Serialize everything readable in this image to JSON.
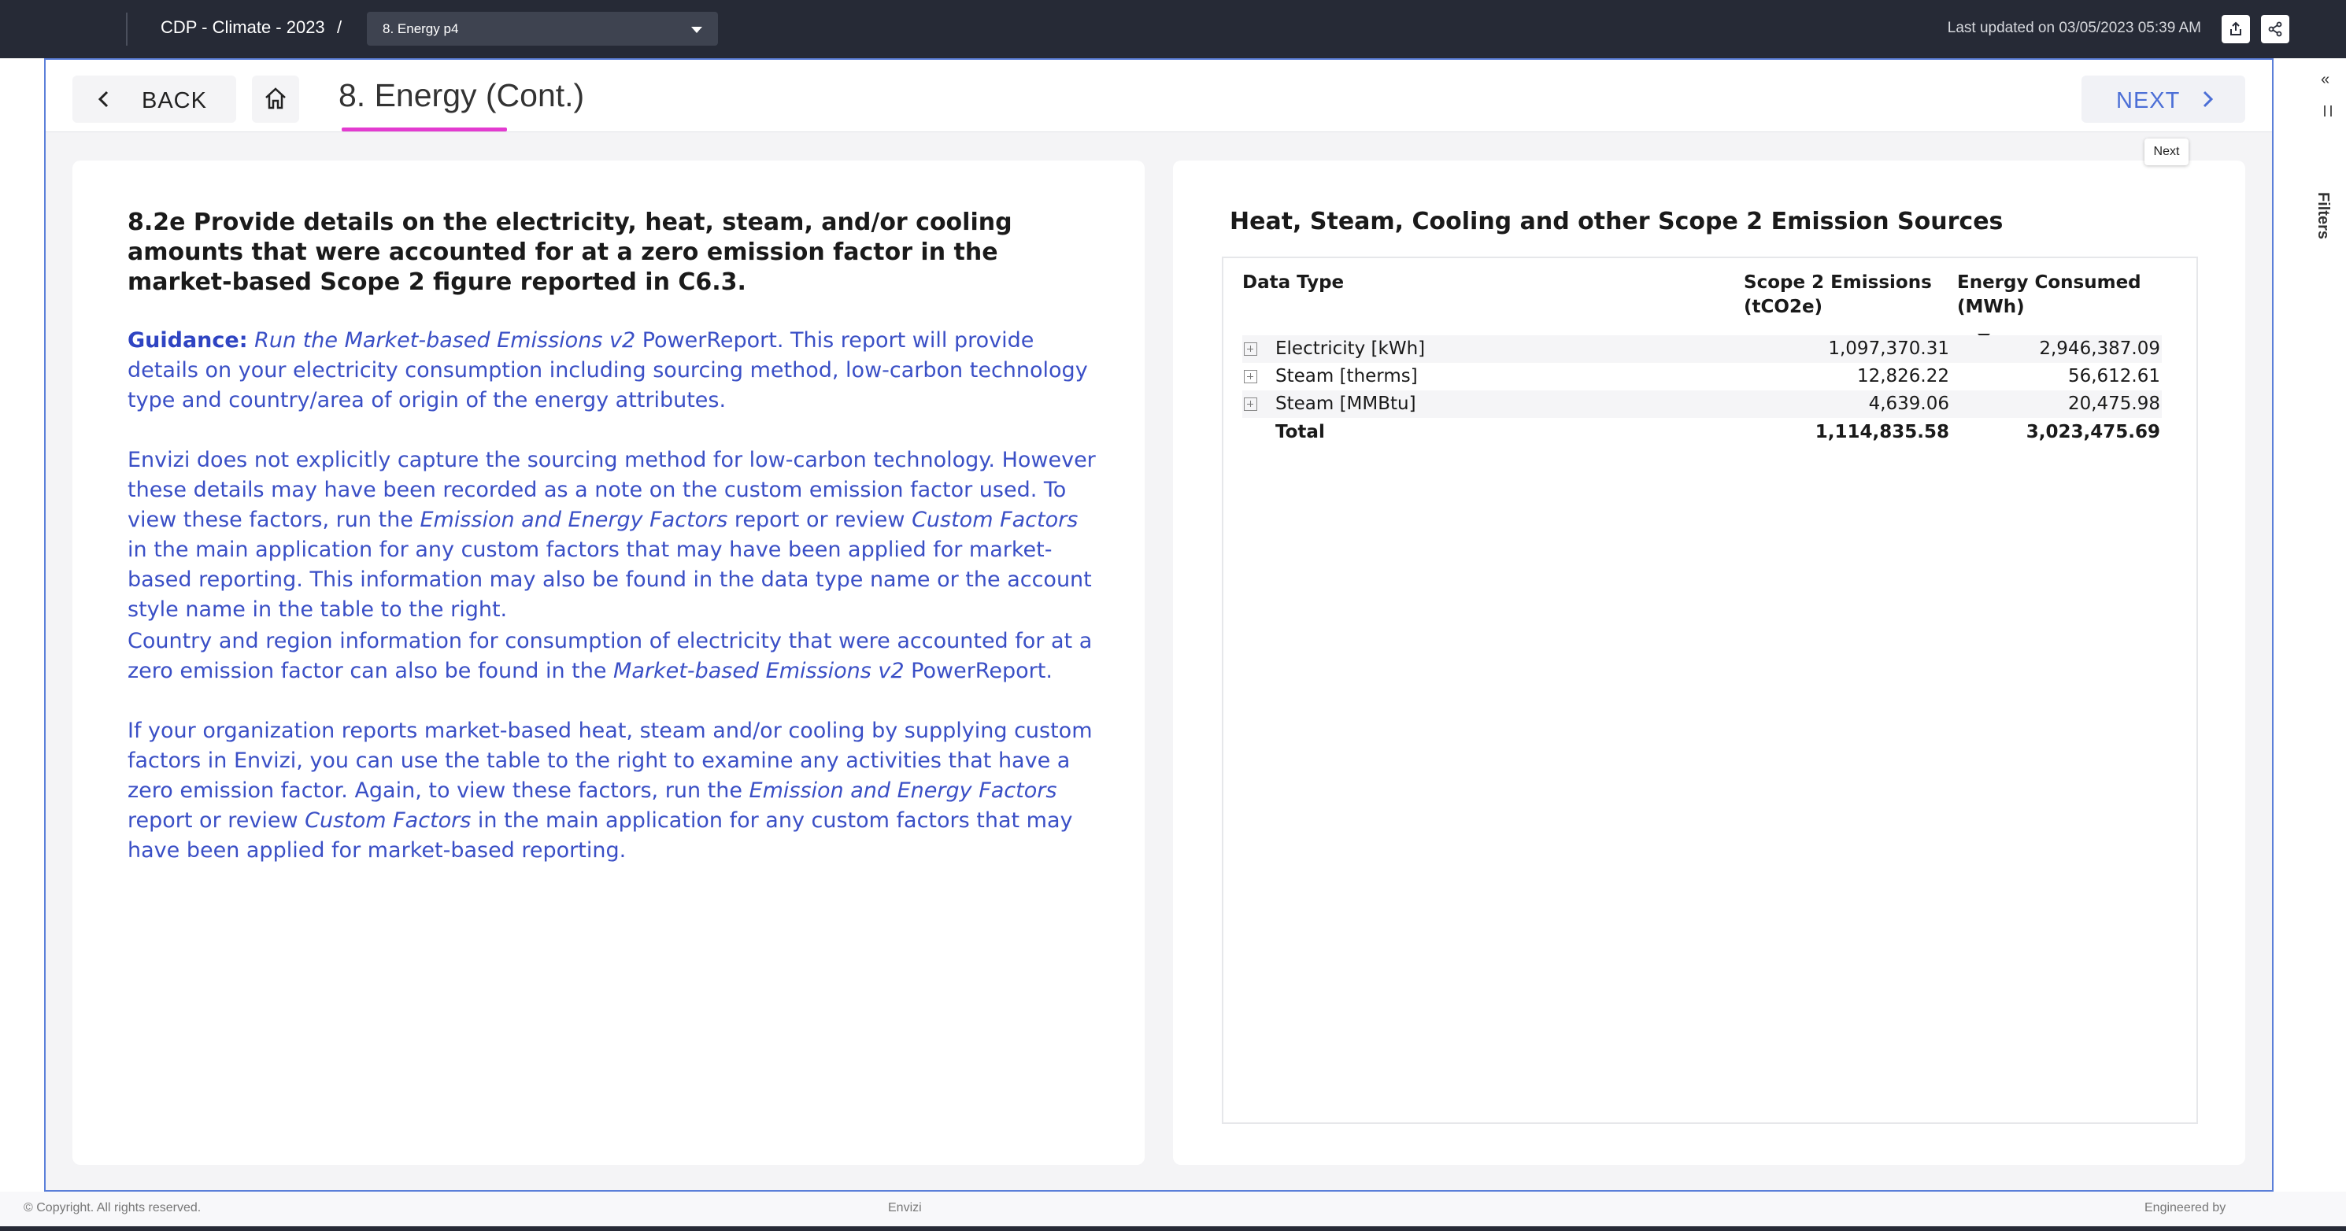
{
  "header": {
    "crumb": "CDP - Climate - 2023",
    "crumb_separator": "/",
    "page_selector": "8. Energy p4",
    "last_updated": "Last updated on 03/05/2023 05:39 AM",
    "export_icon": "export-icon",
    "share_icon": "share-icon"
  },
  "nav": {
    "back_label": "BACK",
    "home_icon": "home-icon",
    "page_title": "8. Energy (Cont.)",
    "next_label": "NEXT",
    "next_tooltip": "Next",
    "accent_color": "#e33bd0",
    "link_color": "#4c6fd6"
  },
  "left": {
    "question": "8.2e Provide details on the electricity, heat, steam, and/or cooling amounts that were accounted for at a zero emission factor in the market-based Scope 2 figure reported in C6.3.",
    "guidance_label": "Guidance:",
    "p1_italic": "Run the Market-based Emissions v2",
    "p1_rest": " PowerReport. This report will provide details on your electricity consumption including sourcing method, low-carbon technology type and country/area of origin of the energy attributes.",
    "p2_a": "Envizi does not explicitly capture the sourcing method for low-carbon technology. However these details may have been recorded as a note on the custom emission factor used. To view these factors, run the ",
    "p2_i1": "Emission and Energy Factors",
    "p2_b": " report or review ",
    "p2_i2": "Custom Factors",
    "p2_c": " in the main application for any custom factors that may have been applied for market-based reporting. This information may also be found in the data type name or the account style name in the table to the right.",
    "p3_a": "Country and region information for consumption of electricity that were accounted for at a zero emission factor can also be found in the ",
    "p3_i1": "Market-based Emissions v2",
    "p3_b": " PowerReport.",
    "p4_a": "If your organization reports market-based heat, steam and/or cooling by supplying custom factors in Envizi, you can use the table to the right to examine any activities that have a zero emission factor. Again, to view these factors, run the ",
    "p4_i1": "Emission and Energy Factors",
    "p4_b": " report or review ",
    "p4_i2": "Custom Factors",
    "p4_c": " in the main application for any custom factors that may have been applied for market-based reporting."
  },
  "right": {
    "heading": "Heat, Steam, Cooling and other Scope 2 Emission Sources",
    "columns": [
      "Data Type",
      "Scope 2 Emissions (tCO2e)",
      "Energy Consumed (MWh)"
    ],
    "rows": [
      {
        "type": "Electricity [kWh]",
        "emissions": "1,097,370.31",
        "energy": "2,946,387.09"
      },
      {
        "type": "Steam [therms]",
        "emissions": "12,826.22",
        "energy": "56,612.61"
      },
      {
        "type": "Steam [MMBtu]",
        "emissions": "4,639.06",
        "energy": "20,475.98"
      }
    ],
    "total": {
      "label": "Total",
      "emissions": "1,114,835.58",
      "energy": "3,023,475.69"
    }
  },
  "footer": {
    "copyright": "© Copyright. All rights reserved.",
    "brand": "Envizi",
    "engineered": "Engineered by"
  },
  "side": {
    "filters_label": "Filters",
    "collapse_glyph": "«"
  }
}
